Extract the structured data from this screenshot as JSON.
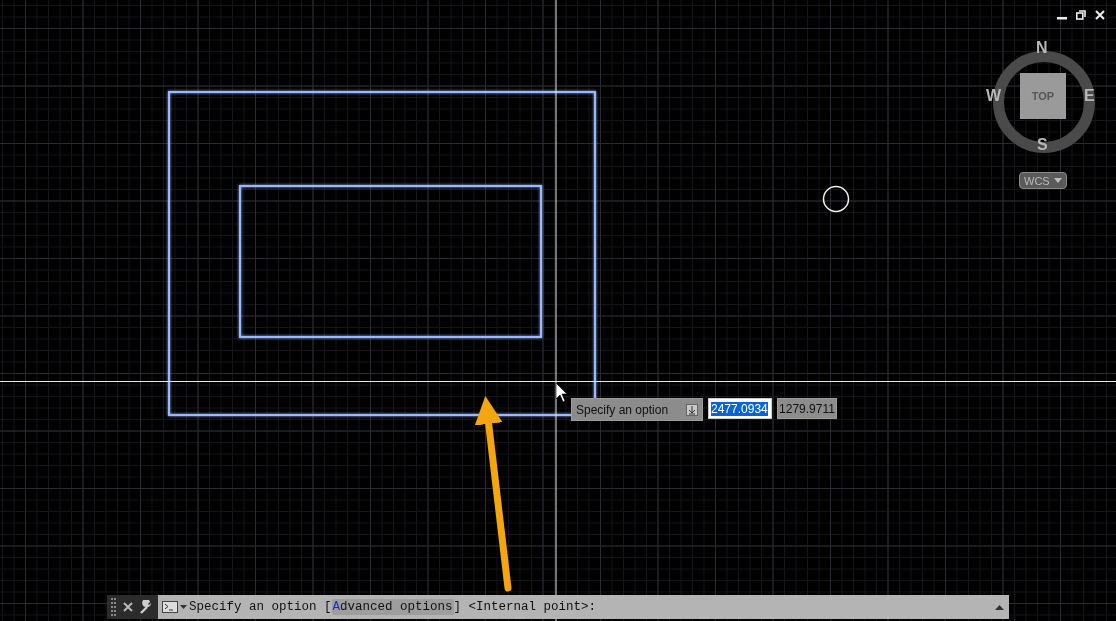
{
  "viewcube": {
    "face": "TOP",
    "north": "N",
    "east": "E",
    "south": "S",
    "west": "W"
  },
  "coordinate_system": {
    "label": "WCS"
  },
  "cursor_tooltip": {
    "prompt": "Specify an option",
    "x_value": "2477.0934",
    "y_value": "1279.9711"
  },
  "command_line": {
    "prompt": "Specify an option [",
    "options": [
      {
        "hotkey": "A",
        "rest": "dvanced options"
      }
    ],
    "suffix": "] <Internal point>:"
  }
}
